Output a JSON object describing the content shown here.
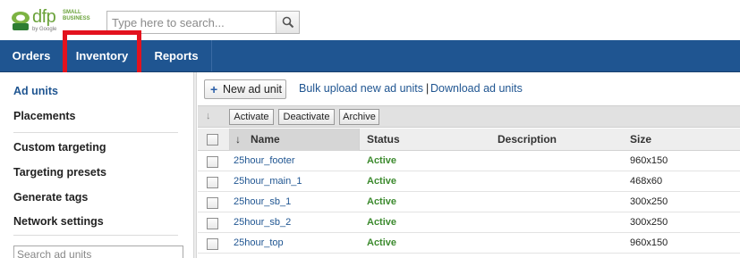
{
  "header": {
    "logo_text": "dfp",
    "logo_sub": "SMALL BUSINESS",
    "logo_by": "by Google",
    "search_placeholder": "Type here to search..."
  },
  "nav": {
    "items": [
      {
        "label": "Orders"
      },
      {
        "label": "Inventory"
      },
      {
        "label": "Reports"
      }
    ],
    "highlight_color": "#e3121e"
  },
  "sidebar": {
    "items": [
      {
        "label": "Ad units"
      },
      {
        "label": "Placements"
      },
      {
        "label": "Custom targeting"
      },
      {
        "label": "Targeting presets"
      },
      {
        "label": "Generate tags"
      },
      {
        "label": "Network settings"
      }
    ],
    "search_placeholder": "Search ad units"
  },
  "toolbar": {
    "new_label": "New ad unit",
    "bulk_link": "Bulk upload new ad units",
    "separator": "|",
    "download_link": "Download ad units"
  },
  "actions": {
    "activate": "Activate",
    "deactivate": "Deactivate",
    "archive": "Archive"
  },
  "table": {
    "columns": {
      "name": "Name",
      "status": "Status",
      "description": "Description",
      "size": "Size"
    },
    "rows": [
      {
        "name": "25hour_footer",
        "status": "Active",
        "description": "",
        "size": "960x150"
      },
      {
        "name": "25hour_main_1",
        "status": "Active",
        "description": "",
        "size": "468x60"
      },
      {
        "name": "25hour_sb_1",
        "status": "Active",
        "description": "",
        "size": "300x250"
      },
      {
        "name": "25hour_sb_2",
        "status": "Active",
        "description": "",
        "size": "300x250"
      },
      {
        "name": "25hour_top",
        "status": "Active",
        "description": "",
        "size": "960x150"
      }
    ]
  },
  "colors": {
    "nav_bg": "#1f5591",
    "link": "#1f5591",
    "status_active": "#3c8a2e",
    "brand_green": "#6aa23a"
  }
}
